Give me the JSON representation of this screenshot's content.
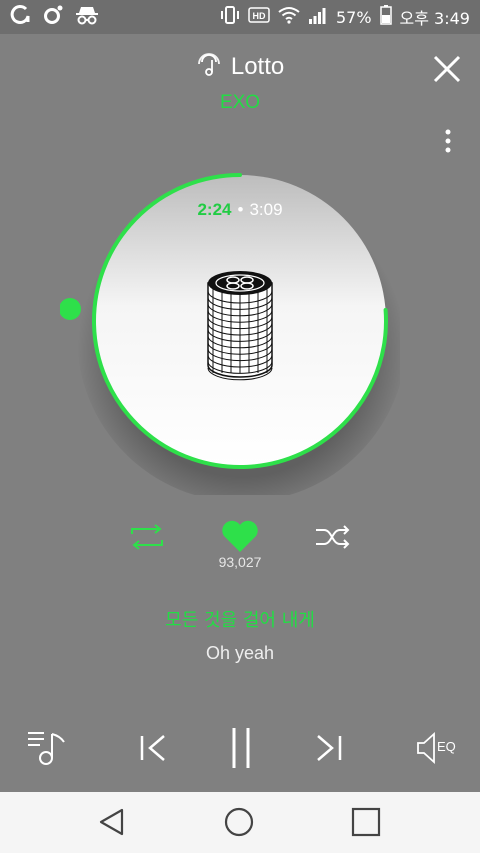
{
  "status_bar": {
    "left_icons": [
      "app-g-icon",
      "app-o-icon",
      "incognito-icon"
    ],
    "right_icons": [
      "vibrate-icon",
      "hd-icon",
      "wifi-icon",
      "signal-icon",
      "battery-icon"
    ],
    "battery_percent": "57%",
    "time": "오후 3:49"
  },
  "player": {
    "title": "Lotto",
    "artist": "EXO",
    "current_time": "2:24",
    "separator": "•",
    "total_time": "3:09",
    "progress_fraction": 0.762,
    "like_count": "93,027",
    "lyric_current": "모든 것을 걸어 내게",
    "lyric_next": "Oh yeah",
    "liked": true,
    "eq_label": "EQ"
  },
  "colors": {
    "background": "#808080",
    "accent": "#22dd44",
    "navbar": "#f5f5f5"
  }
}
